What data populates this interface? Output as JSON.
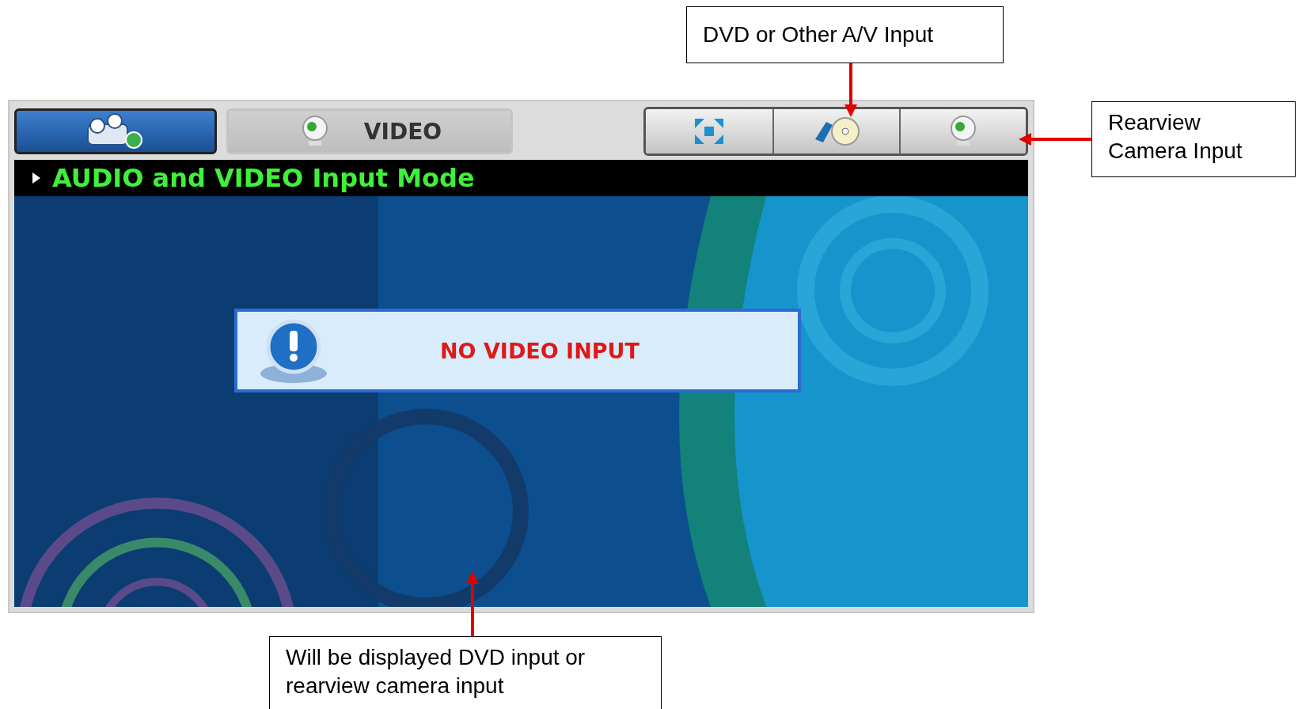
{
  "screen": {
    "tabs": [
      {
        "kind": "device",
        "selected": true
      },
      {
        "kind": "webcam",
        "label": "VIDEO",
        "selected": false
      }
    ],
    "source_buttons": [
      {
        "kind": "expand"
      },
      {
        "kind": "disc"
      },
      {
        "kind": "webcam"
      }
    ],
    "header": "AUDIO and VIDEO Input Mode",
    "message": "NO VIDEO INPUT"
  },
  "callouts": [
    {
      "kind": "top",
      "text": "DVD or Other A/V Input"
    },
    {
      "kind": "right",
      "text": "Rearview Camera Input"
    },
    {
      "kind": "bottom",
      "text": "Will be displayed DVD input or rearview camera input"
    }
  ]
}
